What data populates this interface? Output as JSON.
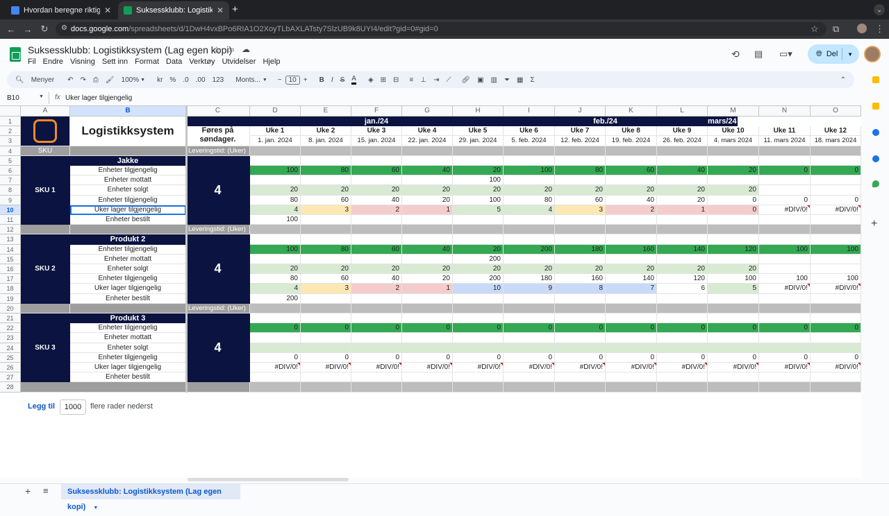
{
  "browser": {
    "tabs": [
      {
        "title": "Hvordan beregne riktig varela",
        "color": "#4285f4"
      },
      {
        "title": "Suksessklubb: Logistikksystem",
        "color": "#0f9d58"
      }
    ],
    "new_tab": "+",
    "url_domain": "docs.google.com",
    "url_path": "/spreadsheets/d/1DwH4vxBPo6RIA1O2XoyTLbAXLATsty7SlzUB9k8UYI4/edit?gid=0#gid=0"
  },
  "app": {
    "title": "Suksessklubb: Logistikksystem (Lag egen kopi)",
    "menus": [
      "Fil",
      "Endre",
      "Visning",
      "Sett inn",
      "Format",
      "Data",
      "Verktøy",
      "Utvidelser",
      "Hjelp"
    ],
    "share_label": "Del",
    "accent": "#0b57d0",
    "navy": "#0b1340"
  },
  "format_bar": {
    "search": "Menyer",
    "zoom": "100%",
    "currency": "kr",
    "percent": "%",
    "dec_minus": ".0",
    "dec_plus": ".00",
    "num_format": "123",
    "font": "Monts...",
    "font_size": "10",
    "bold": "B",
    "italic": "I",
    "strike": "S",
    "text_color": "A"
  },
  "formula_bar": {
    "name_box": "B10",
    "fx": "fx",
    "content": "Uker lager tilgjengelig"
  },
  "columns": [
    "A",
    "B",
    "C",
    "D",
    "E",
    "F",
    "G",
    "H",
    "I",
    "J",
    "K",
    "L",
    "M",
    "N",
    "O"
  ],
  "rows": [
    "1",
    "2",
    "3",
    "4",
    "5",
    "6",
    "7",
    "8",
    "9",
    "10",
    "11",
    "12",
    "13",
    "14",
    "15",
    "16",
    "17",
    "18",
    "19",
    "20",
    "21",
    "22",
    "23",
    "24",
    "25",
    "26",
    "27",
    "28"
  ],
  "sheet_header": {
    "title": "Logistikksystem",
    "fores": "Føres på søndager.",
    "months": [
      "jan./24",
      "feb./24",
      "mars/24"
    ],
    "weeks": [
      "Uke 1",
      "Uke 2",
      "Uke 3",
      "Uke 4",
      "Uke 5",
      "Uke 6",
      "Uke 7",
      "Uke 8",
      "Uke 9",
      "Uke 10",
      "Uke 11",
      "Uke 12"
    ],
    "dates": [
      "1. jan. 2024",
      "8. jan. 2024",
      "15. jan. 2024",
      "22. jan. 2024",
      "29. jan. 2024",
      "5. feb. 2024",
      "12. feb. 2024",
      "19. feb. 2024",
      "26. feb. 2024",
      "4. mars 2024",
      "11. mars 2024",
      "18. mars 2024"
    ],
    "sku_label": "SKU",
    "lead_label": "Leveringstid: (Uker)"
  },
  "row_labels": [
    "Enheter tilgjengelig",
    "Enheter mottatt",
    "Enheter solgt",
    "Enheter tilgjengelig",
    "Uker lager tilgjengelig",
    "Enheter bestilt"
  ],
  "products": [
    {
      "name": "Jakke",
      "sku": "SKU 1",
      "lead": "4",
      "rows": [
        [
          "100",
          "80",
          "60",
          "40",
          "20",
          "100",
          "80",
          "60",
          "40",
          "20",
          "0",
          "0"
        ],
        [
          "",
          "",
          "",
          "",
          "100",
          "",
          "",
          "",
          "",
          "",
          "",
          ""
        ],
        [
          "20",
          "20",
          "20",
          "20",
          "20",
          "20",
          "20",
          "20",
          "20",
          "20",
          "",
          ""
        ],
        [
          "80",
          "60",
          "40",
          "20",
          "100",
          "80",
          "60",
          "40",
          "20",
          "0",
          "0",
          "0"
        ],
        [
          "4",
          "3",
          "2",
          "1",
          "5",
          "4",
          "3",
          "2",
          "1",
          "0",
          "#DIV/0!",
          "#DIV/0!"
        ],
        [
          "100",
          "",
          "",
          "",
          "",
          "",
          "",
          "",
          "",
          "",
          "",
          ""
        ]
      ]
    },
    {
      "name": "Produkt 2",
      "sku": "SKU 2",
      "lead": "4",
      "rows": [
        [
          "100",
          "80",
          "60",
          "40",
          "20",
          "200",
          "180",
          "160",
          "140",
          "120",
          "100",
          "100"
        ],
        [
          "",
          "",
          "",
          "",
          "200",
          "",
          "",
          "",
          "",
          "",
          "",
          ""
        ],
        [
          "20",
          "20",
          "20",
          "20",
          "20",
          "20",
          "20",
          "20",
          "20",
          "20",
          "",
          ""
        ],
        [
          "80",
          "60",
          "40",
          "20",
          "200",
          "180",
          "160",
          "140",
          "120",
          "100",
          "100",
          "100"
        ],
        [
          "4",
          "3",
          "2",
          "1",
          "10",
          "9",
          "8",
          "7",
          "6",
          "5",
          "#DIV/0!",
          "#DIV/0!"
        ],
        [
          "200",
          "",
          "",
          "",
          "",
          "",
          "",
          "",
          "",
          "",
          "",
          ""
        ]
      ]
    },
    {
      "name": "Produkt 3",
      "sku": "SKU 3",
      "lead": "4",
      "rows": [
        [
          "0",
          "0",
          "0",
          "0",
          "0",
          "0",
          "0",
          "0",
          "0",
          "0",
          "0",
          "0"
        ],
        [
          "",
          "",
          "",
          "",
          "",
          "",
          "",
          "",
          "",
          "",
          "",
          ""
        ],
        [
          "",
          "",
          "",
          "",
          "",
          "",
          "",
          "",
          "",
          "",
          "",
          ""
        ],
        [
          "0",
          "0",
          "0",
          "0",
          "0",
          "0",
          "0",
          "0",
          "0",
          "0",
          "0",
          "0"
        ],
        [
          "#DIV/0!",
          "#DIV/0!",
          "#DIV/0!",
          "#DIV/0!",
          "#DIV/0!",
          "#DIV/0!",
          "#DIV/0!",
          "#DIV/0!",
          "#DIV/0!",
          "#DIV/0!",
          "#DIV/0!",
          "#DIV/0!"
        ],
        [
          "",
          "",
          "",
          "",
          "",
          "",
          "",
          "",
          "",
          "",
          "",
          ""
        ]
      ]
    }
  ],
  "footer": {
    "add_label": "Legg til",
    "add_count": "1000",
    "add_suffix": "flere rader nederst",
    "sheet_tab": "Suksessklubb: Logistikksystem (Lag egen kopi)"
  }
}
